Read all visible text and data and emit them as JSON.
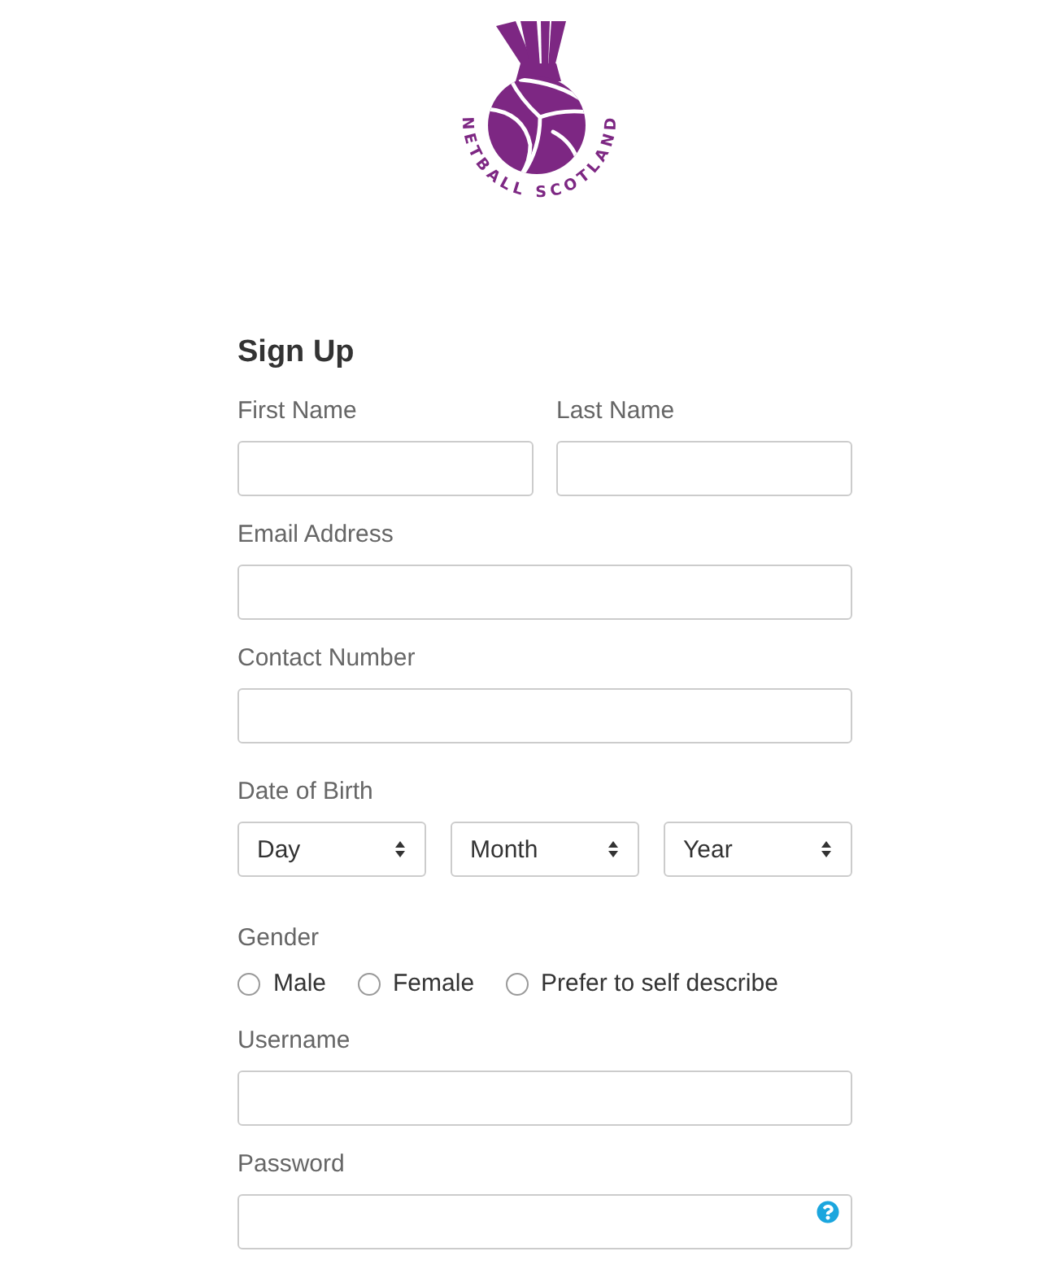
{
  "logo": {
    "wordmark": "NETBALL SCOTLAND"
  },
  "form": {
    "title": "Sign Up",
    "first_name": {
      "label": "First Name"
    },
    "last_name": {
      "label": "Last Name"
    },
    "email": {
      "label": "Email Address"
    },
    "contact_number": {
      "label": "Contact Number"
    },
    "date_of_birth": {
      "label": "Date of Birth",
      "selects": [
        {
          "value": "Day"
        },
        {
          "value": "Month"
        },
        {
          "value": "Year"
        }
      ]
    },
    "gender": {
      "label": "Gender",
      "options": [
        {
          "label": "Male",
          "selected": false
        },
        {
          "label": "Female",
          "selected": false
        },
        {
          "label": "Prefer to self describe",
          "selected": false
        }
      ]
    },
    "username": {
      "label": "Username"
    },
    "password": {
      "label": "Password",
      "help": true
    }
  }
}
